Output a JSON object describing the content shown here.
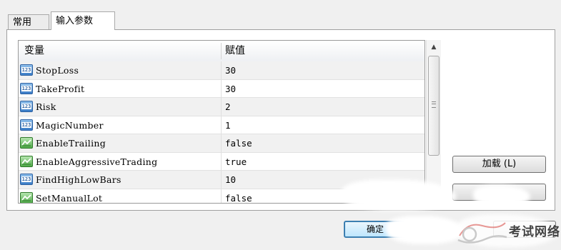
{
  "tabs": [
    {
      "label": "常用",
      "active": false
    },
    {
      "label": "输入参数",
      "active": true
    }
  ],
  "grid": {
    "columns": [
      "变量",
      "赋值"
    ],
    "rows": [
      {
        "type": "number",
        "name": "StopLoss",
        "value": "30"
      },
      {
        "type": "number",
        "name": "TakeProfit",
        "value": "30"
      },
      {
        "type": "number",
        "name": "Risk",
        "value": "2"
      },
      {
        "type": "number",
        "name": "MagicNumber",
        "value": "1"
      },
      {
        "type": "bool",
        "name": "EnableTrailing",
        "value": "false"
      },
      {
        "type": "bool",
        "name": "EnableAggressiveTrading",
        "value": "true"
      },
      {
        "type": "number",
        "name": "FindHighLowBars",
        "value": "10"
      },
      {
        "type": "bool",
        "name": "SetManualLot",
        "value": "false"
      }
    ],
    "number_icon_text": "123"
  },
  "buttons": {
    "load": "加载 (L)",
    "ok": "确定"
  },
  "watermark": {
    "text": "考试网络"
  },
  "colors": {
    "window_bg": "#f0f0f0",
    "number_icon": "#3a7cc6",
    "bool_icon": "#4faa48",
    "ok_border": "#3c7fb1"
  }
}
